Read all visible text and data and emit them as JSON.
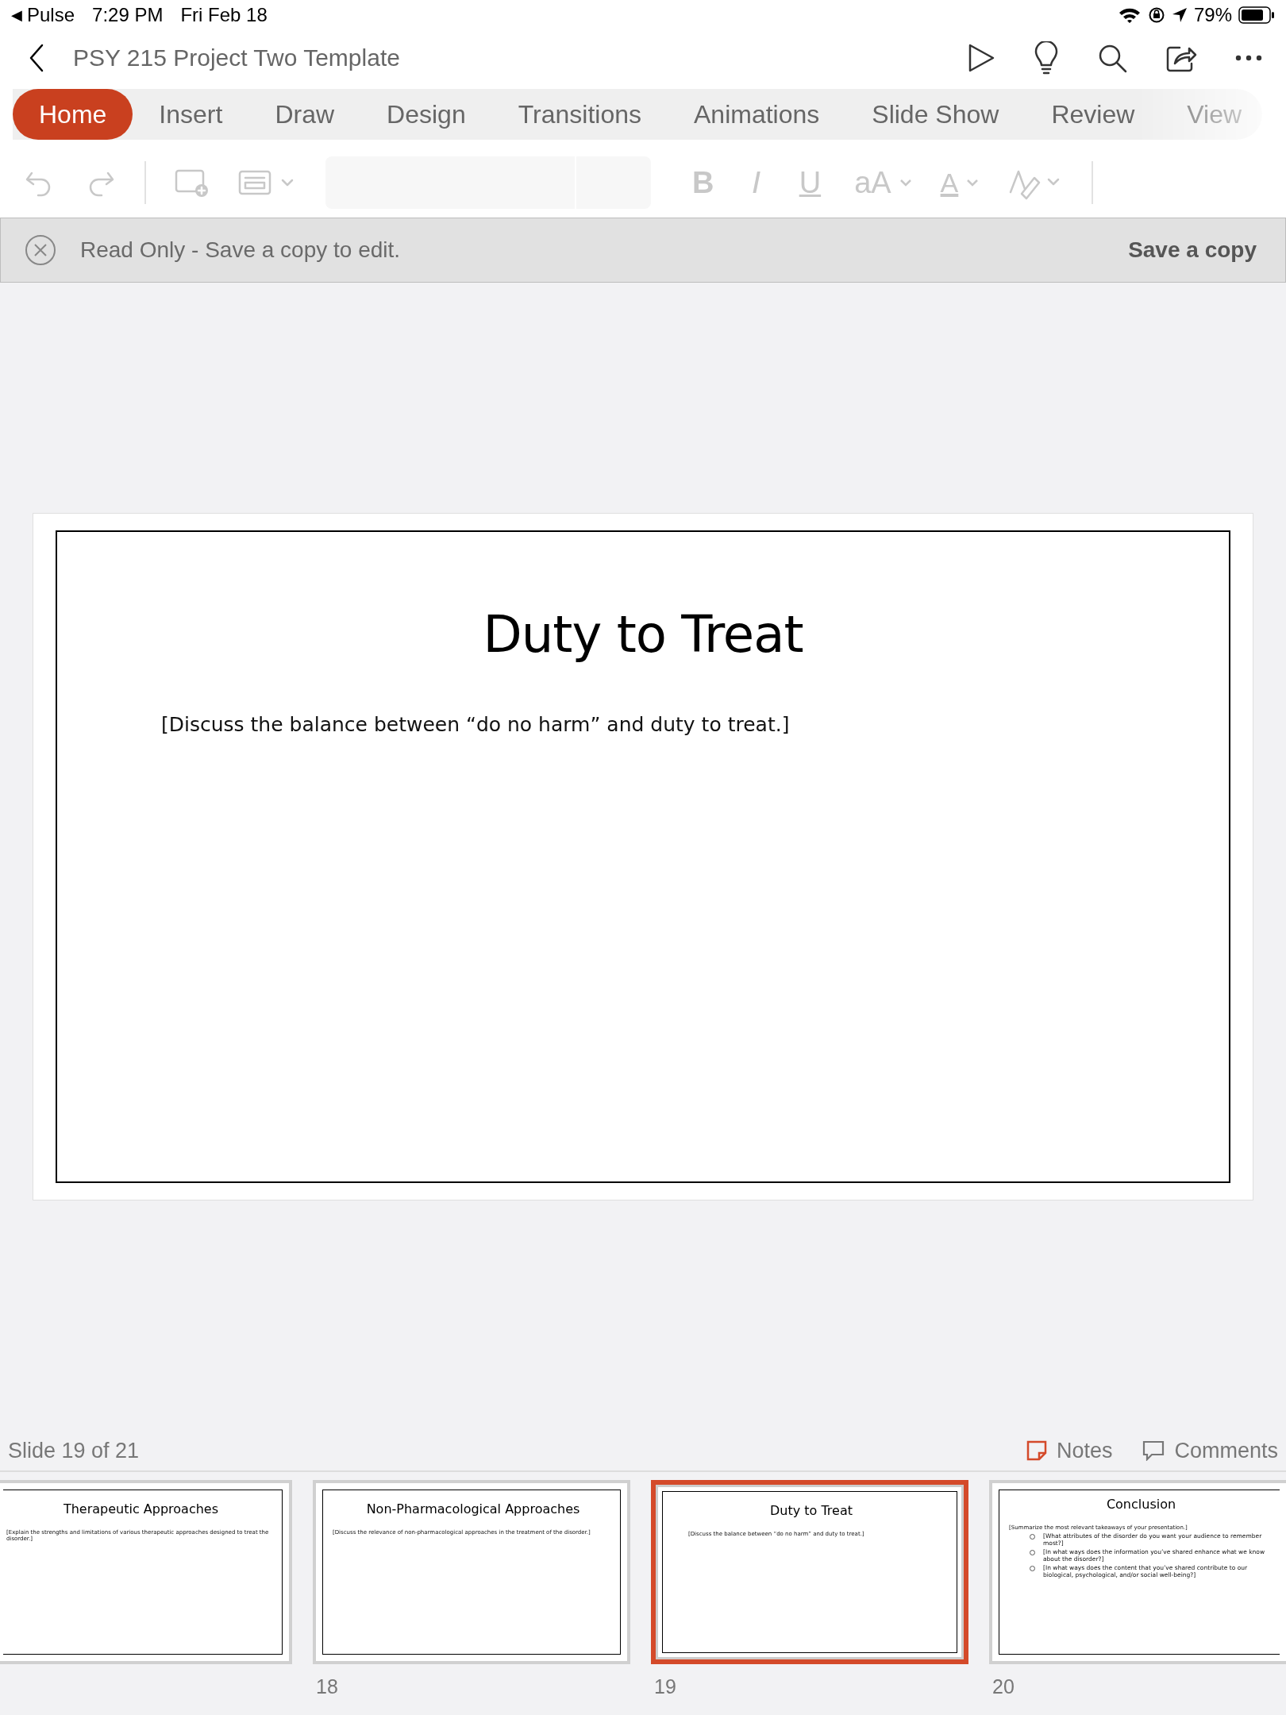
{
  "status_bar": {
    "back_glyph": "◀",
    "app": "Pulse",
    "time": "7:29 PM",
    "date": "Fri Feb 18",
    "battery": "79%"
  },
  "title_bar": {
    "title": "PSY 215 Project Two Template"
  },
  "tabs": [
    {
      "label": "Home",
      "selected": true
    },
    {
      "label": "Insert",
      "selected": false
    },
    {
      "label": "Draw",
      "selected": false
    },
    {
      "label": "Design",
      "selected": false
    },
    {
      "label": "Transitions",
      "selected": false
    },
    {
      "label": "Animations",
      "selected": false
    },
    {
      "label": "Slide Show",
      "selected": false
    },
    {
      "label": "Review",
      "selected": false
    },
    {
      "label": "View",
      "selected": false
    }
  ],
  "toolbar": {
    "disabled": true,
    "items": [
      {
        "kind": "undo"
      },
      {
        "kind": "redo"
      },
      {
        "kind": "divider"
      },
      {
        "kind": "new-slide"
      },
      {
        "kind": "layout"
      },
      {
        "kind": "font-field"
      },
      {
        "kind": "size-field"
      },
      {
        "kind": "bold",
        "text": "B"
      },
      {
        "kind": "italic",
        "text": "I"
      },
      {
        "kind": "underline",
        "text": "U"
      },
      {
        "kind": "font-size",
        "text": "aA"
      },
      {
        "kind": "font-color",
        "text": "A"
      },
      {
        "kind": "highlight"
      },
      {
        "kind": "divider"
      }
    ]
  },
  "banner": {
    "message": "Read Only - Save a copy to edit.",
    "action": "Save a copy"
  },
  "slide": {
    "title": "Duty to Treat",
    "body": "[Discuss the balance between “do no harm” and duty to treat.]"
  },
  "footer": {
    "counter": "Slide 19 of 21",
    "notes": "Notes",
    "comments": "Comments"
  },
  "thumbnails": [
    {
      "title": "Therapeutic Approaches",
      "body": "[Explain the strengths and limitations of various therapeutic approaches designed to treat the disorder.]",
      "selected": false
    },
    {
      "number": "18",
      "title": "Non-Pharmacological Approaches",
      "body": "[Discuss the relevance of non-pharmacological approaches in the treatment of the disorder.]",
      "selected": false
    },
    {
      "number": "19",
      "title": "Duty to Treat",
      "body": "[Discuss the balance between “do no harm” and duty to treat.]",
      "selected": true
    },
    {
      "number": "20",
      "title": "Conclusion",
      "body": "[Summarize the most relevant takeaways of your presentation.]",
      "selected": false,
      "bullets": [
        "[What attributes of the disorder do you want your audience to remember most?]",
        "[In what ways does the information you’ve shared enhance what we know about the disorder?]",
        "[In what ways does the content that you’ve shared contribute to our biological, psychological, and/or social well-being?]"
      ]
    }
  ]
}
